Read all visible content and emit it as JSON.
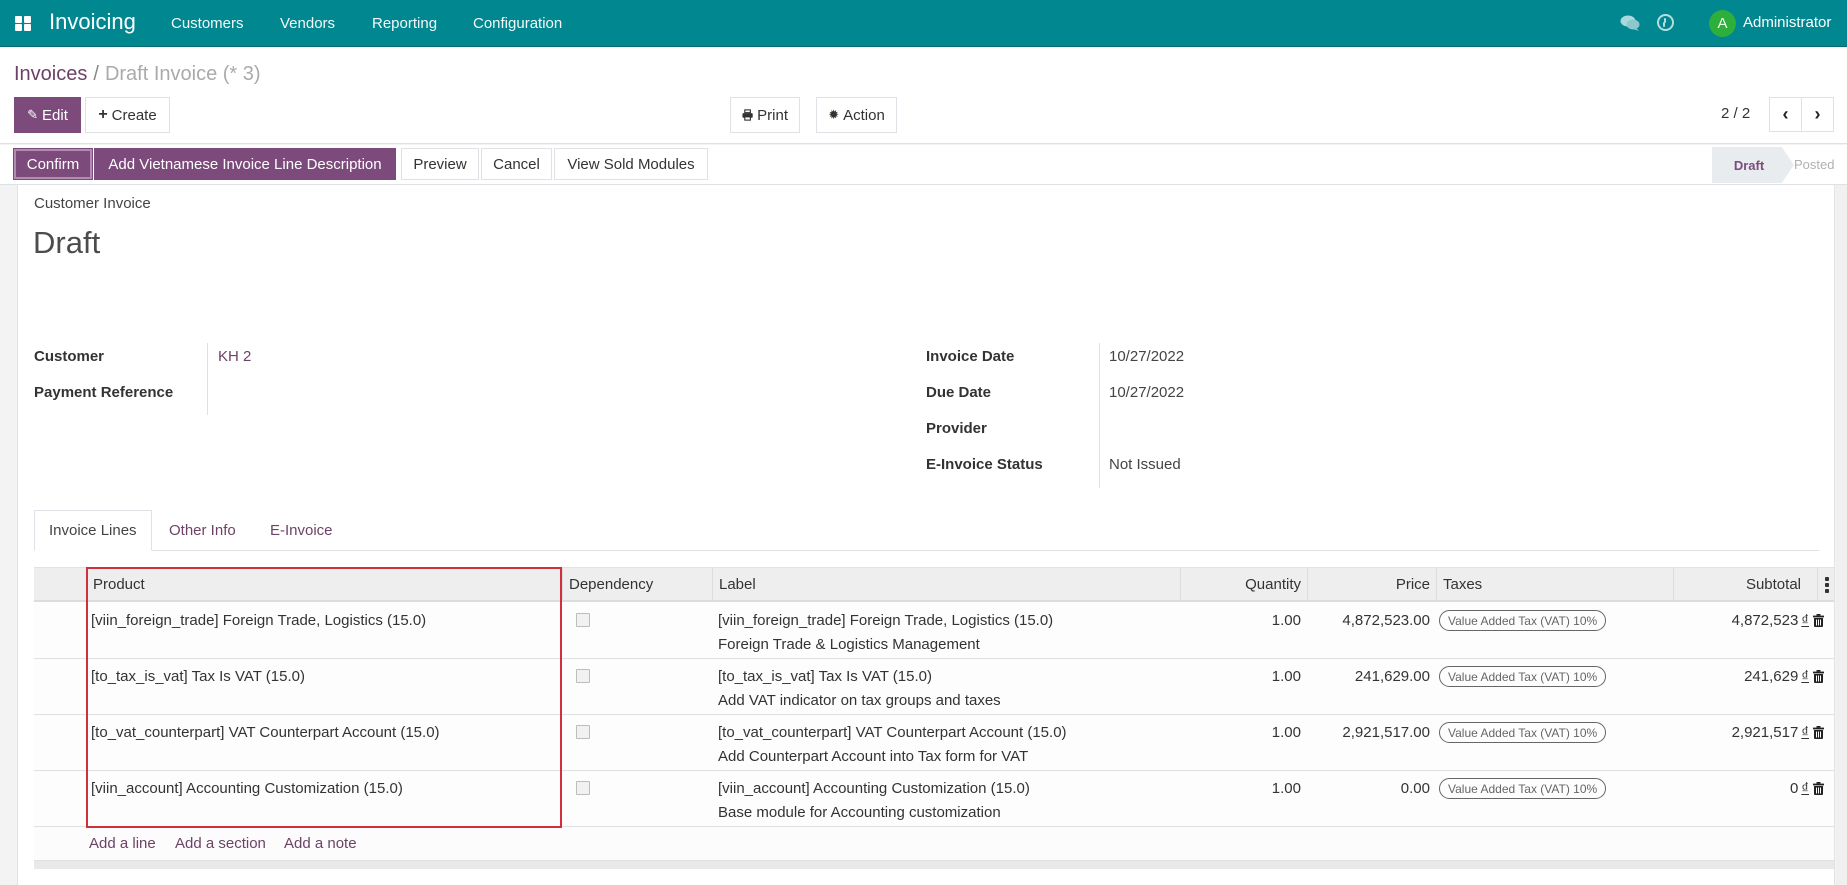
{
  "navbar": {
    "app_icon": "apps-grid-icon",
    "app_name": "Invoicing",
    "menu": [
      "Customers",
      "Vendors",
      "Reporting",
      "Configuration"
    ],
    "icons": [
      "chat-icon",
      "clock-icon"
    ],
    "user_initial": "A",
    "user_name": "Administrator",
    "avatar_color": "#2eae3a",
    "bar_color": "#00878f"
  },
  "breadcrumb": {
    "parent": "Invoices",
    "separator": "/",
    "current": "Draft Invoice (* 3)"
  },
  "toolbar": {
    "edit_label": "Edit",
    "create_label": "Create",
    "print_label": "Print",
    "action_label": "Action",
    "pager": "2 / 2",
    "prev_icon": "chevron-left-icon",
    "next_icon": "chevron-right-icon",
    "primary_color": "#7c4a7b"
  },
  "statusbar": {
    "buttons": [
      "Confirm",
      "Add Vietnamese Invoice Line Description",
      "Preview",
      "Cancel",
      "View Sold Modules"
    ],
    "stages": [
      "Draft",
      "Posted"
    ],
    "active_stage": "Draft"
  },
  "form": {
    "doc_type": "Customer Invoice",
    "title": "Draft",
    "left_fields": [
      {
        "label": "Customer",
        "value": "KH 2"
      },
      {
        "label": "Payment Reference",
        "value": ""
      }
    ],
    "right_fields": [
      {
        "label": "Invoice Date",
        "value": "10/27/2022"
      },
      {
        "label": "Due Date",
        "value": "10/27/2022"
      },
      {
        "label": "Provider",
        "value": ""
      },
      {
        "label": "E-Invoice Status",
        "value": "Not Issued"
      }
    ]
  },
  "tabs": [
    {
      "label": "Invoice Lines",
      "active": true
    },
    {
      "label": "Other Info",
      "active": false
    },
    {
      "label": "E-Invoice",
      "active": false
    }
  ],
  "lines": {
    "columns": [
      "Product",
      "Dependency",
      "Label",
      "Quantity",
      "Price",
      "Taxes",
      "Subtotal"
    ],
    "rows": [
      {
        "product": "[viin_foreign_trade] Foreign Trade, Logistics (15.0)",
        "dependency": false,
        "label": "[viin_foreign_trade] Foreign Trade, Logistics (15.0)",
        "description": "Foreign Trade & Logistics Management",
        "quantity": "1.00",
        "price": "4,872,523.00",
        "tax": "Value Added Tax (VAT) 10%",
        "subtotal": "4,872,523",
        "currency": "₫"
      },
      {
        "product": "[to_tax_is_vat] Tax Is VAT (15.0)",
        "dependency": false,
        "label": "[to_tax_is_vat] Tax Is VAT (15.0)",
        "description": "Add VAT indicator on tax groups and taxes",
        "quantity": "1.00",
        "price": "241,629.00",
        "tax": "Value Added Tax (VAT) 10%",
        "subtotal": "241,629",
        "currency": "₫"
      },
      {
        "product": "[to_vat_counterpart] VAT Counterpart Account (15.0)",
        "dependency": false,
        "label": "[to_vat_counterpart] VAT Counterpart Account (15.0)",
        "description": "Add Counterpart Account into Tax form for VAT",
        "quantity": "1.00",
        "price": "2,921,517.00",
        "tax": "Value Added Tax (VAT) 10%",
        "subtotal": "2,921,517",
        "currency": "₫"
      },
      {
        "product": "[viin_account] Accounting Customization (15.0)",
        "dependency": false,
        "label": "[viin_account] Accounting Customization (15.0)",
        "description": "Base module for Accounting customization",
        "quantity": "1.00",
        "price": "0.00",
        "tax": "Value Added Tax (VAT) 10%",
        "subtotal": "0",
        "currency": "₫"
      }
    ],
    "add_links": [
      "Add a line",
      "Add a section",
      "Add a note"
    ],
    "highlight_color": "#d12f3a"
  }
}
